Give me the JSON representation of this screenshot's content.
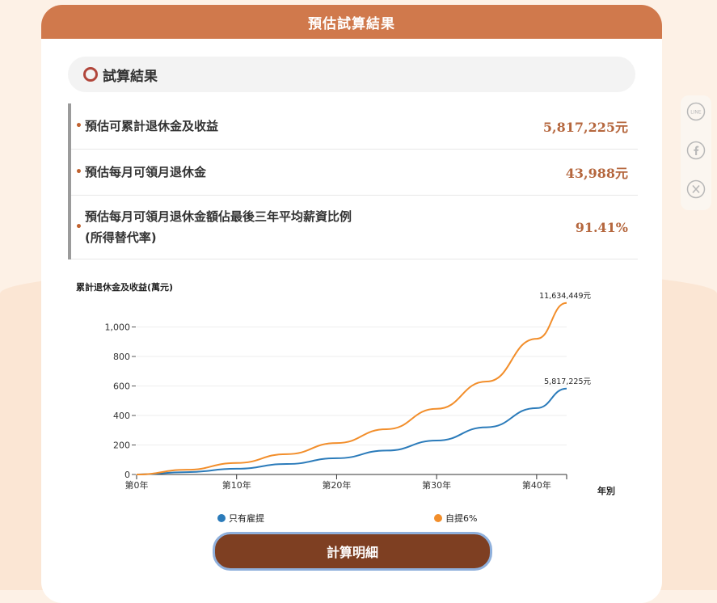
{
  "header": {
    "title": "預估試算結果"
  },
  "section": {
    "title": "試算結果"
  },
  "results": [
    {
      "label": "預估可累計退休金及收益",
      "label2": "",
      "value": "5,817,225元"
    },
    {
      "label": "預估每月可領月退休金",
      "label2": "",
      "value": "43,988元"
    },
    {
      "label": "預估每月可領月退休金額佔最後三年平均薪資比例",
      "label2": "(所得替代率)",
      "value": "91.41%"
    }
  ],
  "chart_data": {
    "type": "line",
    "ylabel": "累計退休金及收益(萬元)",
    "xlabel": "年別",
    "ylim": [
      0,
      1200
    ],
    "yticks": [
      0,
      200,
      400,
      600,
      800,
      1000
    ],
    "ytick_labels": [
      "0",
      "200",
      "400",
      "600",
      "800",
      "1,000"
    ],
    "xticks": [
      0,
      10,
      20,
      30,
      40
    ],
    "xtick_labels": [
      "第0年",
      "第10年",
      "第20年",
      "第30年",
      "第40年"
    ],
    "x": [
      0,
      5,
      10,
      15,
      20,
      25,
      30,
      35,
      40,
      43
    ],
    "series": [
      {
        "name": "只有雇提",
        "color": "#2b7bba",
        "values": [
          0,
          16,
          39,
          71,
          110,
          162,
          230,
          320,
          450,
          582
        ],
        "end_label": "5,817,225元"
      },
      {
        "name": "自提6%",
        "color": "#f28e2b",
        "values": [
          0,
          32,
          78,
          138,
          213,
          307,
          445,
          630,
          920,
          1163
        ],
        "end_label": "11,634,449元"
      }
    ],
    "legend_position": "bottom"
  },
  "button": {
    "label": "計算明細"
  },
  "share": {
    "line_icon_text": "LINE"
  }
}
